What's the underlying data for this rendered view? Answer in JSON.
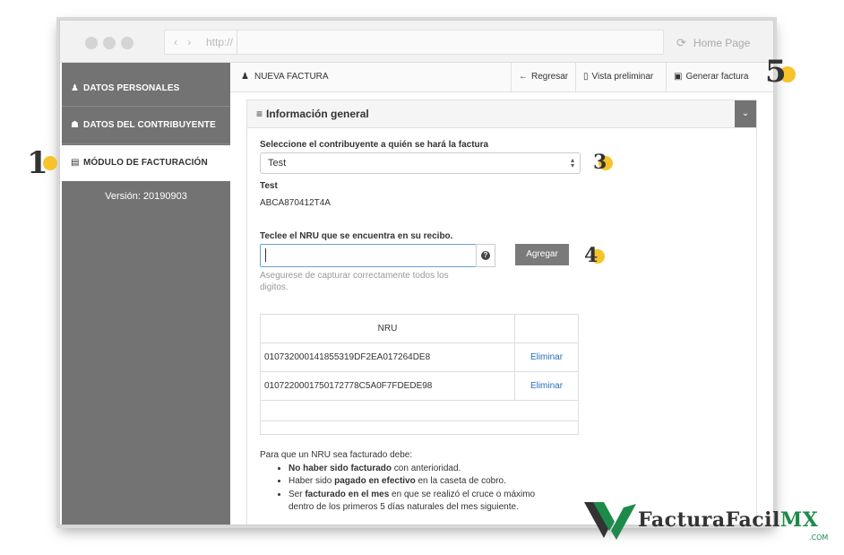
{
  "browser": {
    "nav_arrows": "‹ ›",
    "url": "http://",
    "home_label": "Home Page"
  },
  "sidebar": {
    "items": [
      {
        "label": "DATOS PERSONALES",
        "icon": "person-icon"
      },
      {
        "label": "DATOS DEL CONTRIBUYENTE",
        "icon": "users-icon"
      },
      {
        "label": "MÓDULO DE FACTURACIÓN",
        "icon": "document-icon"
      }
    ],
    "version": "Versión: 20190903"
  },
  "toolbar": {
    "title": "NUEVA FACTURA",
    "back_label": "Regresar",
    "preview_label": "Vista preliminar",
    "generate_label": "Generar factura"
  },
  "panel": {
    "title": "Información general",
    "select_label": "Seleccione el contribuyente a quién se hará la factura",
    "select_value": "Test",
    "taxpayer_name": "Test",
    "taxpayer_rfc": "ABCA870412T4A",
    "nru_label": "Teclee el NRU que se encuentra en su recibo.",
    "nru_value": "",
    "add_label": "Agregar",
    "hint": "Asegurese de capturar correctamente todos los digitos.",
    "table": {
      "headers": [
        "NRU",
        ""
      ],
      "rows": [
        {
          "nru": "010732000141855319DF2EA017264DE8",
          "action": "Eliminar"
        },
        {
          "nru": "0107220001750172778C5A0F7FDEDE98",
          "action": "Eliminar"
        }
      ]
    },
    "notes_intro": "Para que un NRU sea facturado debe:",
    "notes": [
      {
        "bold": "No haber sido facturado",
        "rest": " con anterioridad."
      },
      {
        "pre": "Haber sido ",
        "bold": "pagado en efectivo",
        "rest": " en la caseta de cobro."
      },
      {
        "pre": "Ser ",
        "bold": "facturado en el mes",
        "rest": " en que se realizó el cruce o máximo dentro de los primeros 5 días naturales del mes siguiente."
      }
    ]
  },
  "annotations": [
    "1",
    "3",
    "4",
    "5"
  ],
  "brand": {
    "name": "FacturaFacil",
    "suffix": "MX",
    "domain": ".COM",
    "accent": "#1e8a4a",
    "marker": "#f6c32b"
  }
}
